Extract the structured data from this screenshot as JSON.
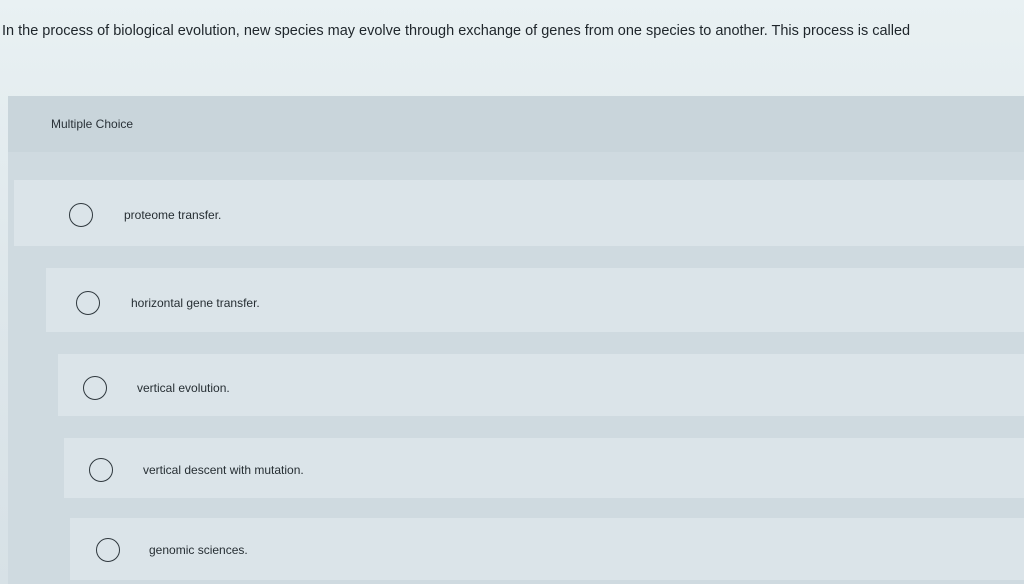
{
  "question": {
    "text": "In the process of biological evolution, new species may evolve through exchange of genes from one species to another. This process is called"
  },
  "quiz": {
    "type_label": "Multiple Choice",
    "options": [
      {
        "label": "proteome transfer."
      },
      {
        "label": "horizontal gene transfer."
      },
      {
        "label": "vertical evolution."
      },
      {
        "label": "vertical descent with mutation."
      },
      {
        "label": "genomic sciences."
      }
    ]
  }
}
